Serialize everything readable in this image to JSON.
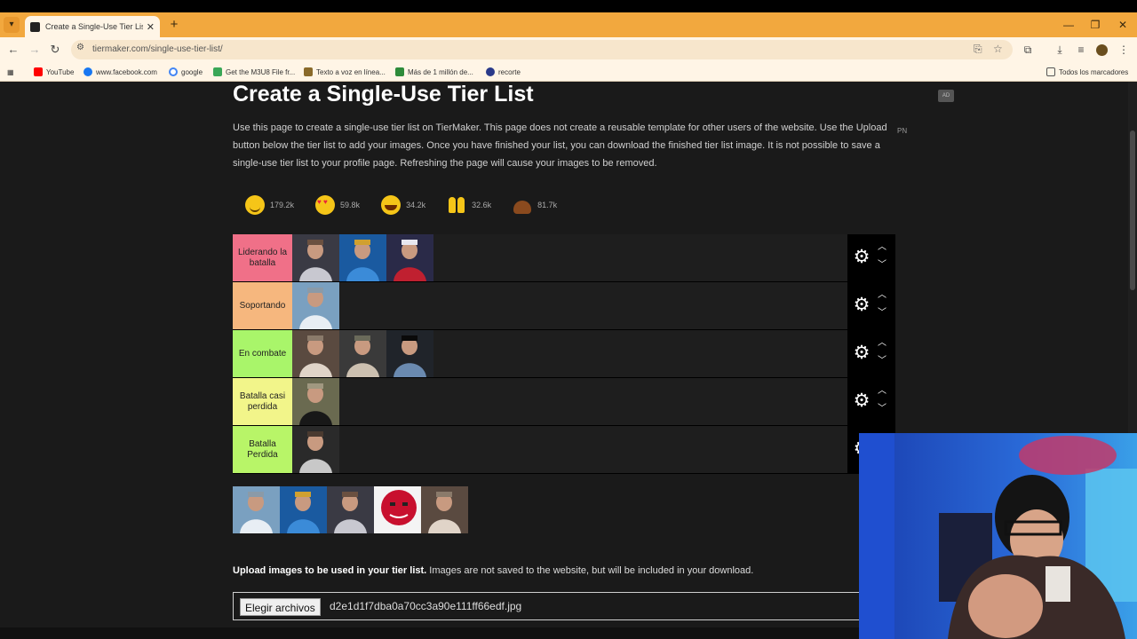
{
  "browser": {
    "tab_title": "Create a Single-Use Tier List (Fi",
    "url": "tiermaker.com/single-use-tier-list/",
    "bookmarks": [
      {
        "label": "YouTube",
        "color": "#ff0000"
      },
      {
        "label": "www.facebook.com",
        "color": "#1877f2"
      },
      {
        "label": "google",
        "color": "#4285f4"
      },
      {
        "label": "Get the M3U8 File fr...",
        "color": "#3aa757"
      },
      {
        "label": "Texto a voz en línea...",
        "color": "#8a6a2a"
      },
      {
        "label": "Más de 1 millón de...",
        "color": "#2e8b3a"
      },
      {
        "label": "recorte",
        "color": "#2a3a8a"
      }
    ],
    "all_bookmarks": "Todos los marcadores"
  },
  "page": {
    "title": "Create a Single-Use Tier List",
    "ad_label": "AD",
    "side_label": "PN",
    "description": "Use this page to create a single-use tier list on TierMaker. This page does not create a reusable template for other users of the website. Use the Upload button below the tier list to add your images. Once you have finished your list, you can download the finished tier list image. It is not possible to save a single-use tier list to your profile page. Refreshing the page will cause your images to be removed.",
    "reactions": [
      {
        "icon": "smile-icon",
        "count": "179.2k"
      },
      {
        "icon": "heart-eyes-icon",
        "count": "59.8k"
      },
      {
        "icon": "laugh-icon",
        "count": "34.2k"
      },
      {
        "icon": "raised-hands-icon",
        "count": "32.6k"
      },
      {
        "icon": "poop-icon",
        "count": "81.7k"
      }
    ],
    "tiers": [
      {
        "label": "Liderando la batalla",
        "color": "#f07088",
        "items": 3
      },
      {
        "label": "Soportando",
        "color": "#f6b77e",
        "items": 1
      },
      {
        "label": "En combate",
        "color": "#a9f56a",
        "items": 3
      },
      {
        "label": "Batalla casi perdida",
        "color": "#f2f58a",
        "items": 1
      },
      {
        "label": "Batalla Perdida",
        "color": "#b8f568",
        "items": 1
      }
    ],
    "pool_items": 5,
    "upload_bold": "Upload images to be used in your tier list.",
    "upload_note": "Images are not saved to the website, but will be included in your download.",
    "file_button": "Elegir archivos",
    "file_name": "d2e1d1f7dba0a70cc3a90e111ff66edf.jpg"
  }
}
